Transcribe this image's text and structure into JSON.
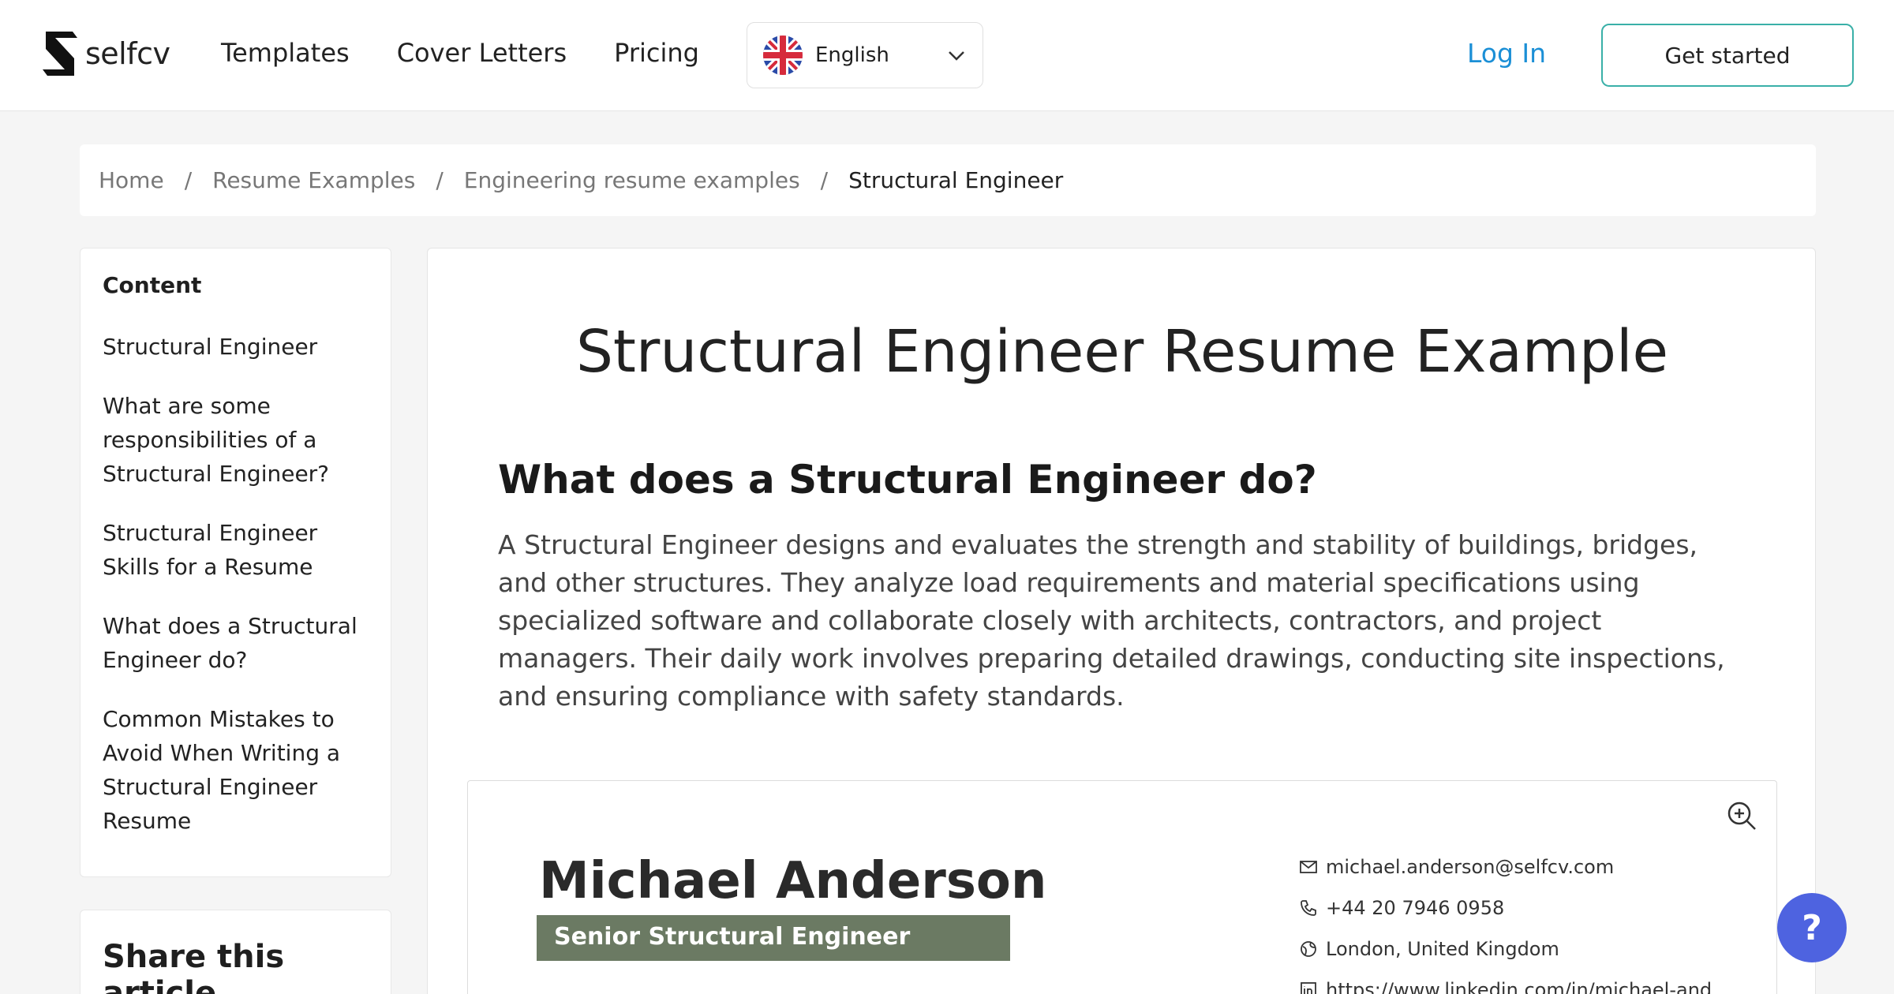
{
  "header": {
    "logo_text": "selfcv",
    "nav": [
      "Templates",
      "Cover Letters",
      "Pricing"
    ],
    "language": "English",
    "login": "Log In",
    "get_started": "Get started"
  },
  "breadcrumb": {
    "items": [
      "Home",
      "Resume Examples",
      "Engineering resume examples"
    ],
    "current": "Structural Engineer",
    "separator": "/"
  },
  "sidebar": {
    "title": "Content",
    "items": [
      "Structural Engineer",
      "What are some responsibilities of a Structural Engineer?",
      "Structural Engineer Skills for a Resume",
      "What does a Structural Engineer do?",
      "Common Mistakes to Avoid When Writing a Structural Engineer Resume"
    ],
    "share_title": "Share this article"
  },
  "article": {
    "title": "Structural Engineer Resume Example",
    "heading": "What does a Structural Engineer do?",
    "paragraph": "A Structural Engineer designs and evaluates the strength and stability of buildings, bridges, and other structures. They analyze load requirements and material specifications using specialized software and collaborate closely with architects, contractors, and project managers. Their daily work involves preparing detailed drawings, conducting site inspections, and ensuring compliance with safety standards."
  },
  "resume": {
    "name": "Michael Anderson",
    "title": "Senior Structural Engineer",
    "email": "michael.anderson@selfcv.com",
    "phone": "+44 20 7946 0958",
    "location": "London, United Kingdom",
    "linkedin": "https://www.linkedin.com/in/michael-and"
  },
  "help_label": "?",
  "colors": {
    "accent": "#3ab0a8",
    "link": "#1b8fd6",
    "resume_band": "#6b7a63",
    "help": "#4e63e0"
  }
}
